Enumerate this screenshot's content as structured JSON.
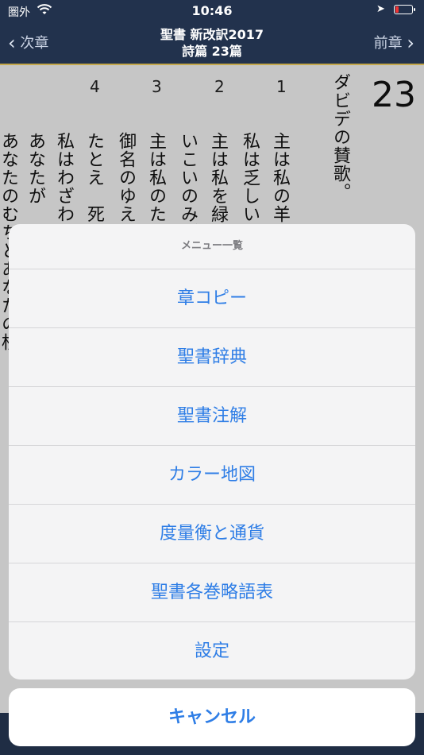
{
  "status": {
    "carrier": "圏外",
    "time": "10:46"
  },
  "nav": {
    "prev_label": "次章",
    "next_label": "前章",
    "title_line1": "聖書 新改訳2017",
    "title_line2": "詩篇 23篇"
  },
  "page": {
    "chapter": "23",
    "heading": "ダビデの賛歌。",
    "verse_numbers": [
      "4",
      "3",
      "2",
      "1"
    ],
    "columns": [
      "主は私の羊",
      "私は乏しい",
      "主は私を緑",
      "いこいのみぎ",
      "主は私のた",
      "御名のゆえ",
      "たとえ　死",
      "私はわざわ",
      "あなたが",
      "あなたのむちとあなたの杖"
    ]
  },
  "sheet": {
    "title": "メニュー一覧",
    "items": [
      "章コピー",
      "聖書辞典",
      "聖書注解",
      "カラー地図",
      "度量衡と通貨",
      "聖書各巻略語表",
      "設定"
    ],
    "cancel": "キャンセル"
  }
}
